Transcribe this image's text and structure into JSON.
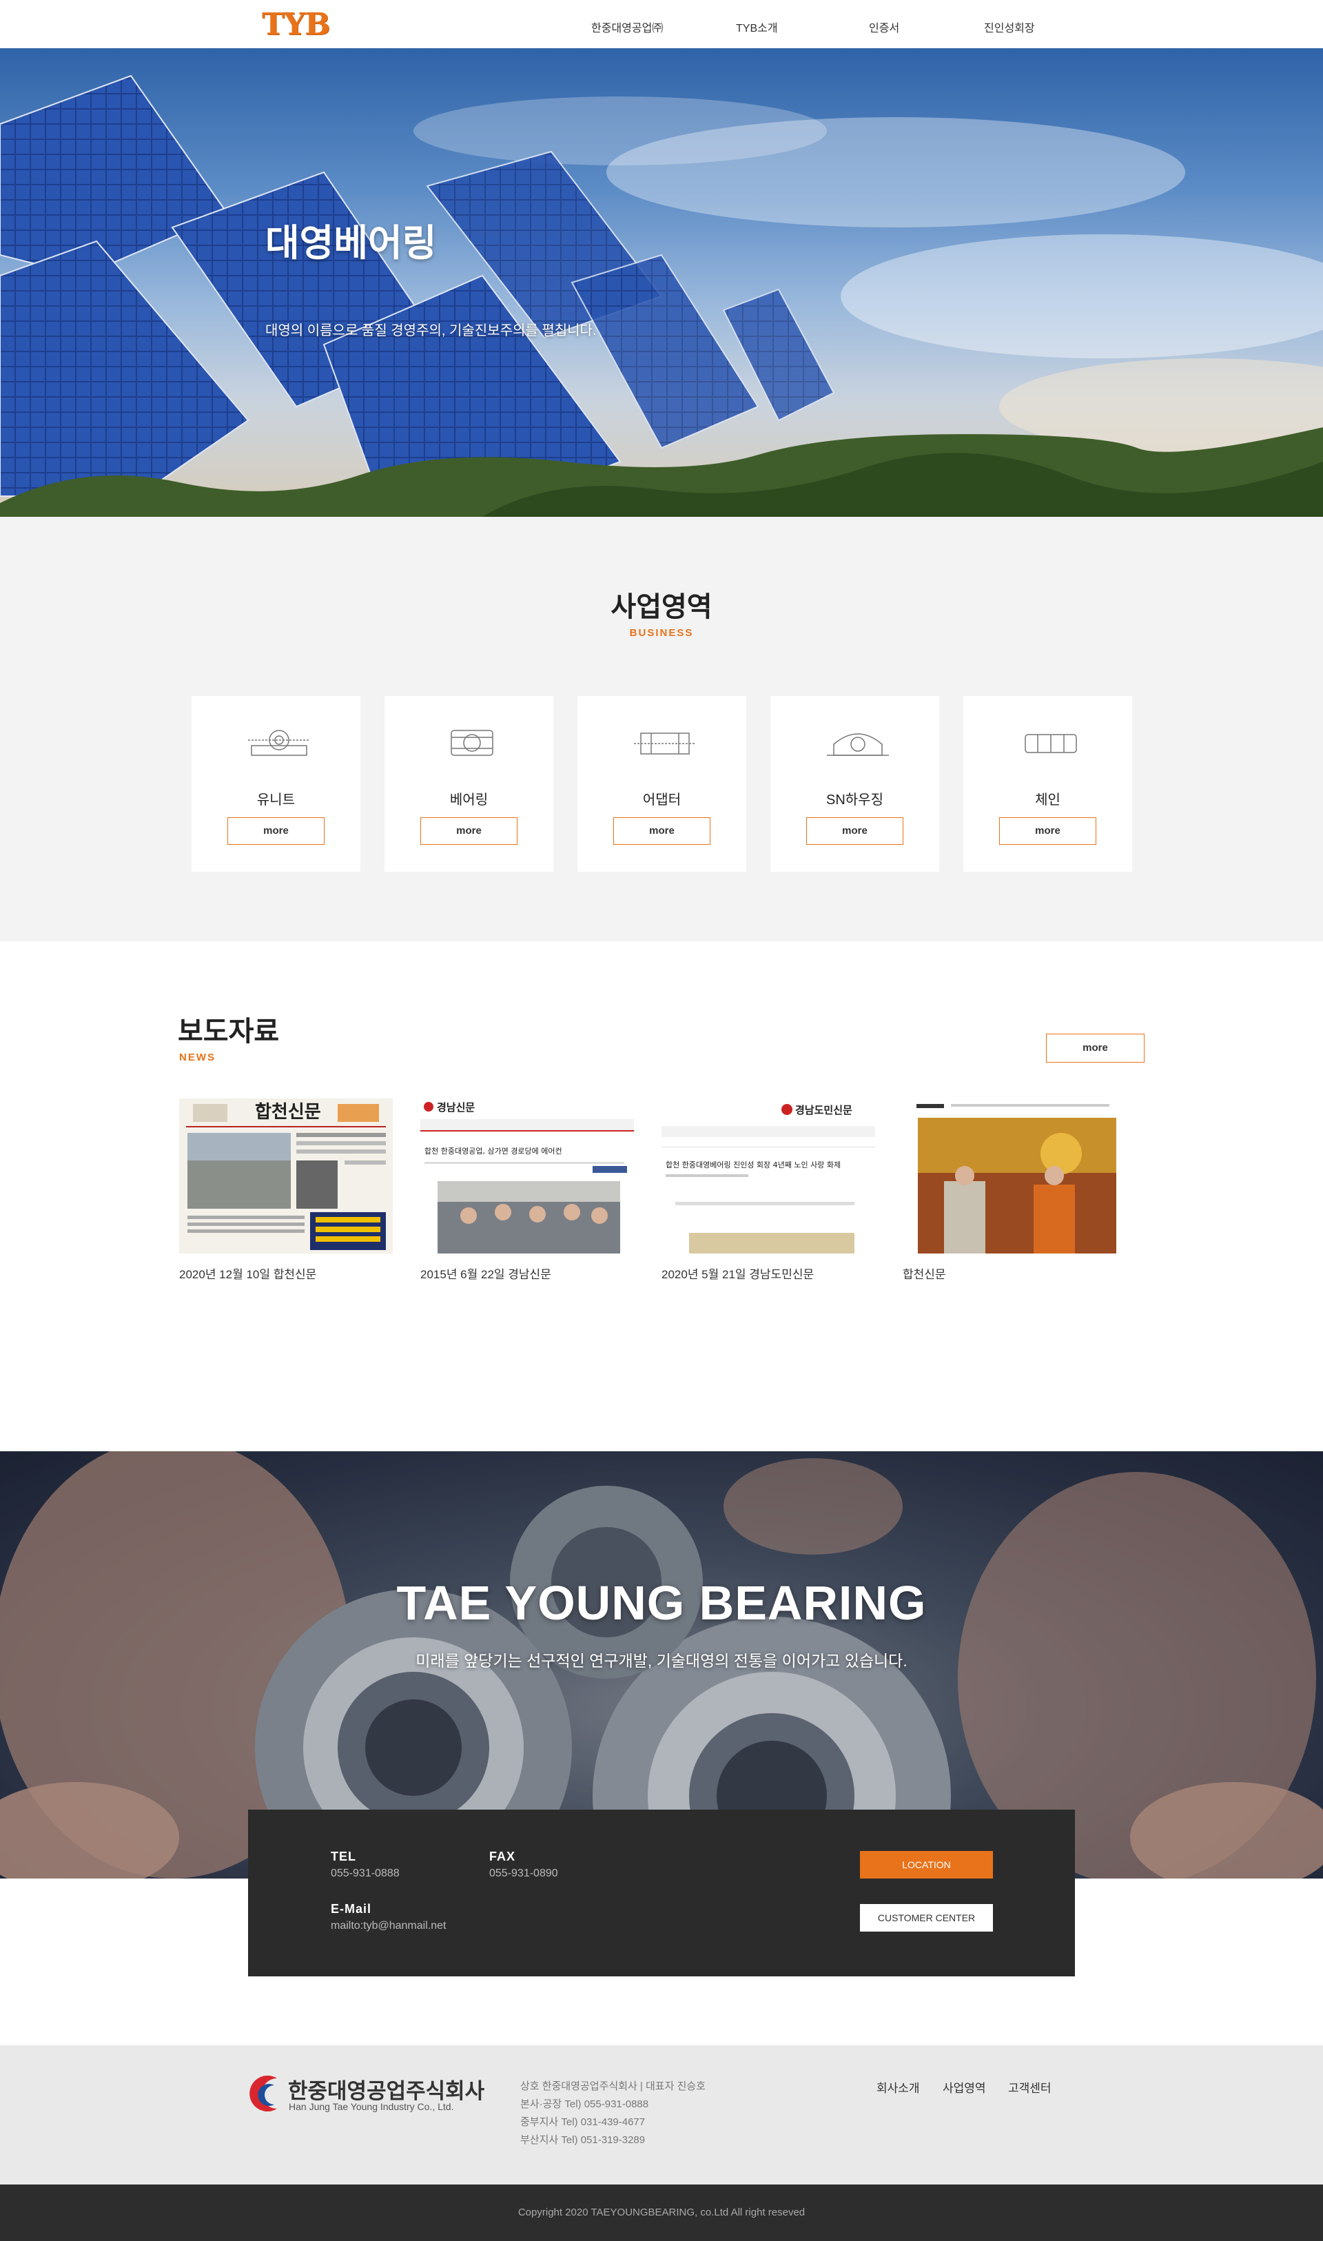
{
  "header": {
    "logo": "TYB",
    "nav": [
      "한중대영공업㈜",
      "TYB소개",
      "인증서",
      "진인성회장"
    ]
  },
  "hero": {
    "title": "대영베어링",
    "subtitle": "대영의 이름으로 품질 경영주의, 기술진보주의를 펼칩니다."
  },
  "business": {
    "title": "사업영역",
    "subtitle": "BUSINESS",
    "cards": [
      {
        "label": "유니트",
        "button": "more"
      },
      {
        "label": "베어링",
        "button": "more"
      },
      {
        "label": "어댑터",
        "button": "more"
      },
      {
        "label": "SN하우징",
        "button": "more"
      },
      {
        "label": "체인",
        "button": "more"
      }
    ]
  },
  "news": {
    "title": "보도자료",
    "subtitle": "NEWS",
    "more": "more",
    "items": [
      {
        "caption": "2020년 12월 10일 합천신문",
        "masthead": "합천신문"
      },
      {
        "caption": "2015년 6월 22일 경남신문",
        "masthead": "경남신문",
        "headline": "합천 한중대영공업, 삼가면 경로당에 에어컨"
      },
      {
        "caption": "2020년 5월 21일 경남도민신문",
        "masthead": "경남도민신문",
        "headline": "합천 한중대영베어링 진인성 회장 4년째 노인 사랑 화제"
      },
      {
        "caption": "합천신문"
      }
    ]
  },
  "banner": {
    "title": "TAE YOUNG BEARING",
    "subtitle": "미래를 앞당기는 선구적인 연구개발, 기술대영의 전통을 이어가고 있습니다."
  },
  "contact": {
    "tel_label": "TEL",
    "tel": "055-931-0888",
    "fax_label": "FAX",
    "fax": "055-931-0890",
    "email_label": "E-Mail",
    "email": "mailto:tyb@hanmail.net",
    "location_button": "LOCATION",
    "customer_button": "CUSTOMER CENTER"
  },
  "footer": {
    "logo_kr": "한중대영공업주식회사",
    "logo_en": "Han Jung Tae Young Industry Co., Ltd.",
    "info": [
      "상호 한중대영공업주식회사 | 대표자 진승호",
      "본사·공장 Tel) 055-931-0888",
      "중부지사 Tel) 031-439-4677",
      "부산지사 Tel) 051-319-3289"
    ],
    "links": [
      "회사소개",
      "사업영역",
      "고객센터"
    ],
    "copyright": "Copyright 2020 TAEYOUNGBEARING, co.Ltd All right reseved"
  },
  "colors": {
    "accent": "#e8731a",
    "dark": "#2b2b2b",
    "footer_bg": "#e9e9e9"
  }
}
